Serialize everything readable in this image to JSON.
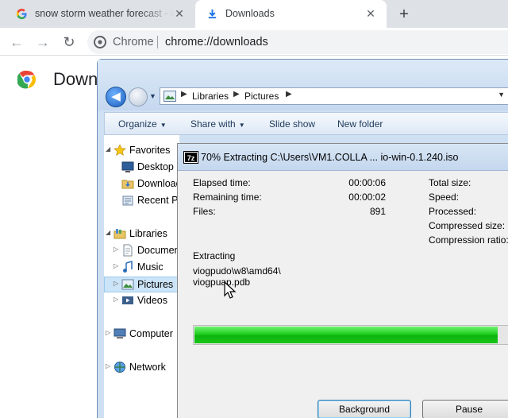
{
  "browser": {
    "tabs": [
      {
        "title": "snow storm weather forecast - G",
        "favicon": "google-g-icon",
        "active": false
      },
      {
        "title": "Downloads",
        "favicon": "download-icon",
        "active": true
      }
    ],
    "omnibox": {
      "origin": "Chrome",
      "url": "chrome://downloads"
    }
  },
  "downloads_page": {
    "title": "Down"
  },
  "explorer": {
    "breadcrumb": [
      "Libraries",
      "Pictures"
    ],
    "commands": [
      "Organize",
      "Share with",
      "Slide show",
      "New folder"
    ],
    "tree": [
      {
        "label": "Favorites",
        "icon": "star-icon"
      },
      {
        "label": "Desktop",
        "icon": "desktop-icon"
      },
      {
        "label": "Downloads",
        "icon": "downloads-folder-icon"
      },
      {
        "label": "Recent Places",
        "icon": "recent-places-icon"
      },
      {
        "label": "Libraries",
        "icon": "libraries-icon"
      },
      {
        "label": "Documents",
        "icon": "documents-icon"
      },
      {
        "label": "Music",
        "icon": "music-icon"
      },
      {
        "label": "Pictures",
        "icon": "pictures-icon"
      },
      {
        "label": "Videos",
        "icon": "videos-icon"
      },
      {
        "label": "Computer",
        "icon": "computer-icon"
      },
      {
        "label": "Network",
        "icon": "network-icon"
      }
    ]
  },
  "zip_dialog": {
    "icon_text": "7z",
    "title": "70% Extracting C:\\Users\\VM1.COLLA ... io-win-0.1.240.iso",
    "elapsed_label": "Elapsed time:",
    "elapsed_value": "00:00:06",
    "remaining_label": "Remaining time:",
    "remaining_value": "00:00:02",
    "files_label": "Files:",
    "files_value": "891",
    "total_size_label": "Total size:",
    "speed_label": "Speed:",
    "processed_label": "Processed:",
    "compressed_size_label": "Compressed size:",
    "compression_ratio_label": "Compression ratio:",
    "extracting_label": "Extracting",
    "current_path": "viogpudo\\w8\\amd64\\",
    "current_file": "viogpuap.pdb",
    "progress_percent": 70,
    "background_button": "Background",
    "pause_button": "Pause"
  },
  "colors": {
    "progress": "#1fce1f",
    "selection": "#cce4f7"
  }
}
